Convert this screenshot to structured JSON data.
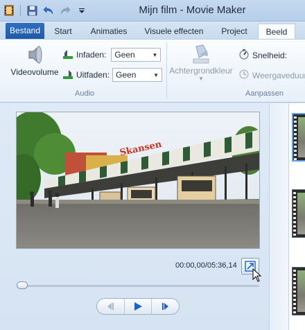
{
  "window": {
    "title": "Mijn film - Movie Maker"
  },
  "quick_access": {
    "icons": [
      "moviemaker-icon",
      "save-icon",
      "undo-icon",
      "redo-icon",
      "customize-dropdown-icon"
    ]
  },
  "ribbon_tabs": [
    {
      "label": "Bestand",
      "active": false,
      "file": true
    },
    {
      "label": "Start",
      "active": false
    },
    {
      "label": "Animaties",
      "active": false
    },
    {
      "label": "Visuele effecten",
      "active": false
    },
    {
      "label": "Project",
      "active": false
    },
    {
      "label": "Beeld",
      "active": true
    }
  ],
  "ribbon": {
    "audio": {
      "group_label": "Audio",
      "video_volume_label": "Videovolume",
      "fade_in_label": "Infaden:",
      "fade_in_value": "Geen",
      "fade_out_label": "Uitfaden:",
      "fade_out_value": "Geen"
    },
    "adjust": {
      "group_label": "Aanpassen",
      "background_color_label": "Achtergrondkleur",
      "speed_label": "Snelheid:",
      "duration_label": "Weergaveduur"
    }
  },
  "preview": {
    "sign_text": "Skansen",
    "timecode": "00:00,00/05:36,14",
    "position_fraction": 0.0
  },
  "colors": {
    "file_tab": "#1f5aa6",
    "accent": "#2e7bcf",
    "play": "#1d63c7"
  }
}
